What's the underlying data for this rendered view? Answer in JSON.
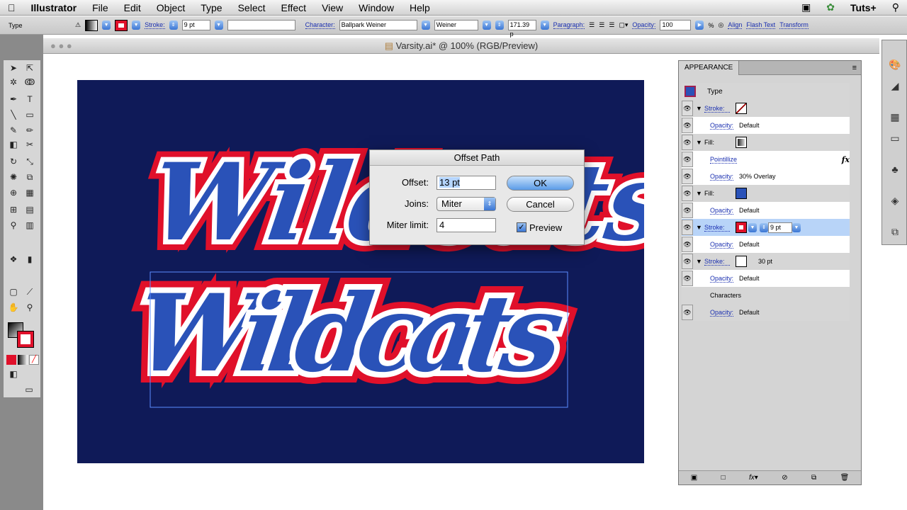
{
  "menubar": {
    "apple": "",
    "app": "Illustrator",
    "items": [
      "File",
      "Edit",
      "Object",
      "Type",
      "Select",
      "Effect",
      "View",
      "Window",
      "Help"
    ],
    "right": "Tuts+"
  },
  "control": {
    "type_label": "Type",
    "stroke_label": "Stroke:",
    "stroke_value": "9 pt",
    "character_label": "Character:",
    "font_family": "Ballpark Weiner",
    "font_style": "Weiner",
    "font_size": "171.39 p",
    "paragraph_label": "Paragraph:",
    "opacity_label": "Opacity:",
    "opacity_value": "100",
    "percent": "%",
    "align": "Align",
    "flash_text": "Flash Text",
    "transform": "Transform"
  },
  "document": {
    "title": "Varsity.ai* @ 100% (RGB/Preview)"
  },
  "artwork": {
    "text": "Wildcats",
    "colors": {
      "fill": "#2a52b8",
      "inner_stroke": "#e0102a",
      "outer_stroke": "#ffffff",
      "background": "#0f1a58"
    }
  },
  "dialog": {
    "title": "Offset Path",
    "offset_label": "Offset:",
    "offset_value": "13 pt",
    "joins_label": "Joins:",
    "joins_value": "Miter",
    "miter_label": "Miter limit:",
    "miter_value": "4",
    "ok": "OK",
    "cancel": "Cancel",
    "preview_label": "Preview",
    "preview_checked": true
  },
  "appearance": {
    "tab": "APPEARANCE",
    "type_label": "Type",
    "rows": [
      {
        "kind": "Stroke:",
        "value": "",
        "style": "g"
      },
      {
        "kind": "Opacity:",
        "value": "Default",
        "style": "w"
      },
      {
        "kind": "Fill:",
        "value": "",
        "style": "g"
      },
      {
        "kind": "Pointillize",
        "value": "fx",
        "style": "w"
      },
      {
        "kind": "Opacity:",
        "value": "30% Overlay",
        "style": "w"
      },
      {
        "kind": "Fill:",
        "value": "",
        "style": "g"
      },
      {
        "kind": "Opacity:",
        "value": "Default",
        "style": "w"
      },
      {
        "kind": "Stroke:",
        "value": "9 pt",
        "style": "sel"
      },
      {
        "kind": "Opacity:",
        "value": "Default",
        "style": "w"
      },
      {
        "kind": "Stroke:",
        "value": "30 pt",
        "style": "g"
      },
      {
        "kind": "Opacity:",
        "value": "Default",
        "style": "w"
      },
      {
        "kind": "Characters",
        "value": "",
        "style": "g"
      },
      {
        "kind": "Opacity:",
        "value": "Default",
        "style": "g"
      }
    ]
  }
}
